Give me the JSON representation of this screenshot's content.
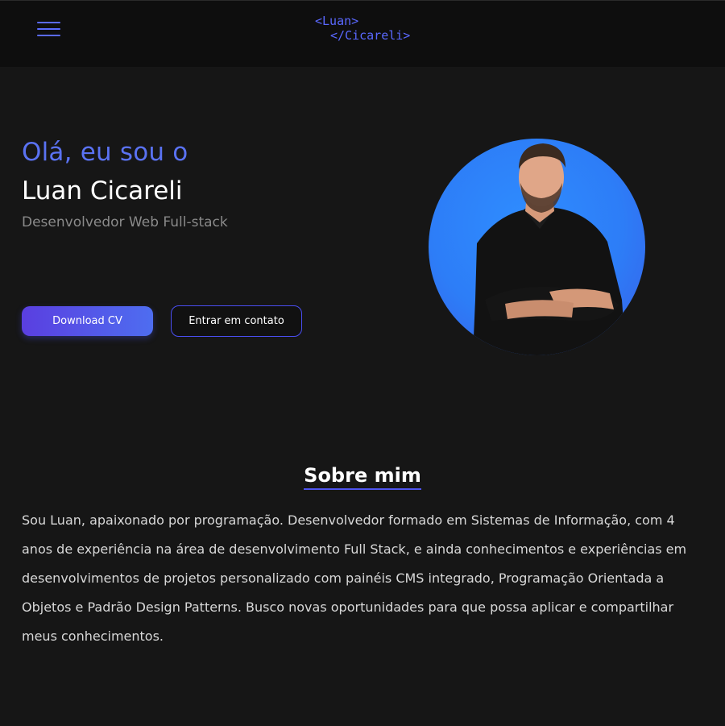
{
  "header": {
    "logo_line1": "<Luan>",
    "logo_line2": "</Cicareli>",
    "menu_icon": "hamburger-menu-icon"
  },
  "hero": {
    "greeting": "Olá, eu sou o",
    "name": "Luan Cicareli",
    "role": "Desenvolvedor Web Full-stack",
    "download_label": "Download CV",
    "contact_label": "Entrar em contato"
  },
  "about": {
    "title": "Sobre mim",
    "text": "Sou Luan, apaixonado por programação. Desenvolvedor formado em Sistemas de Informação, com 4 anos de experiência na área de desenvolvimento Full Stack, e ainda conhecimentos e experiências em desenvolvimentos de projetos personalizado com painéis CMS integrado, Programação Orientada a Objetos e Padrão Design Patterns. Busco novas oportunidades para que possa aplicar e compartilhar meus conhecimentos."
  },
  "colors": {
    "accent": "#5a68ff",
    "background": "#161616",
    "header_background": "#0e0e0e",
    "avatar_background": "#2d7df7"
  }
}
